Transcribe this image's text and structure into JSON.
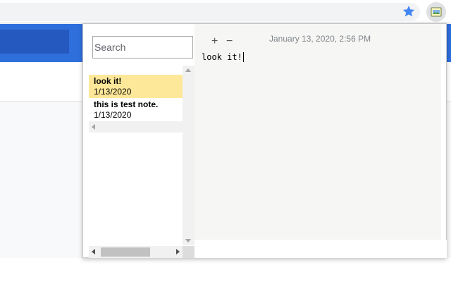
{
  "popup": {
    "search": {
      "placeholder": "Search",
      "value": ""
    },
    "notes": [
      {
        "title": "look it!",
        "date": "1/13/2020",
        "selected": true
      },
      {
        "title": "this is test note.",
        "date": "1/13/2020",
        "selected": false
      }
    ],
    "editor": {
      "add_label": "+",
      "remove_label": "−",
      "timestamp": "January 13, 2020, 2:56 PM",
      "body": "look it!"
    }
  },
  "colors": {
    "selected_note": "#fde89a",
    "editor_bg": "#f6f6f4",
    "page_blue": "#2f6fdc",
    "star": "#4285f4"
  },
  "icons": {
    "star": "bookmark-star-icon",
    "extension": "notes-extension-icon"
  }
}
